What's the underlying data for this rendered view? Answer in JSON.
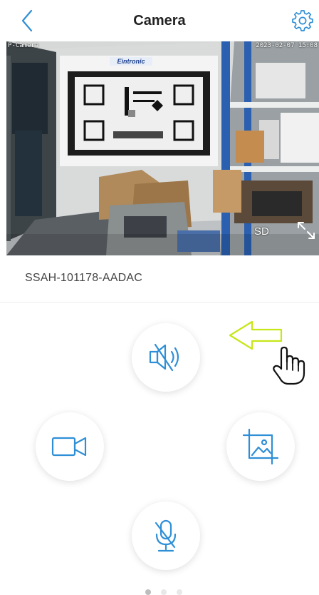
{
  "header": {
    "title": "Camera",
    "back_icon": "chevron-left-icon",
    "settings_icon": "gear-icon"
  },
  "video": {
    "camera_label": "P-Camera",
    "timestamp": "2023-02-07 15:08",
    "chart_brand": "Eintronic",
    "quality_label": "SD",
    "fullscreen_icon": "expand-icon"
  },
  "device": {
    "id": "SSAH-101178-AADAC"
  },
  "controls": {
    "mute_icon": "speaker-muted-icon",
    "record_icon": "video-camera-icon",
    "snapshot_icon": "picture-icon",
    "mic_icon": "microphone-muted-icon"
  },
  "annotations": {
    "arrow_icon": "arrow-left-icon",
    "hand_icon": "hand-pointer-icon"
  },
  "pager": {
    "count": 3,
    "active_index": 0
  },
  "colors": {
    "accent": "#2f8fd6",
    "annotation": "#c8e619"
  }
}
